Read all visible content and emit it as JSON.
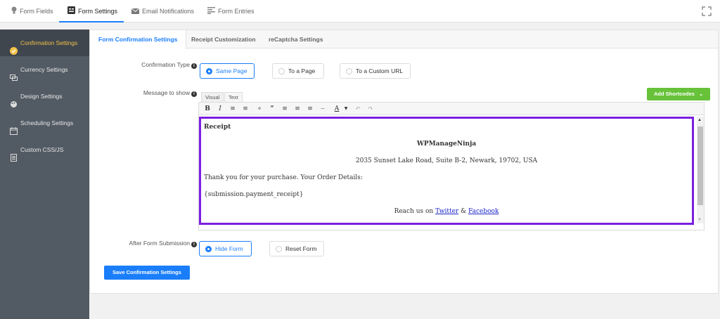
{
  "top_nav": {
    "tabs": [
      {
        "label": "Form Fields"
      },
      {
        "label": "Form Settings"
      },
      {
        "label": "Email Notifications"
      },
      {
        "label": "Form Entries"
      }
    ]
  },
  "sidebar": {
    "items": [
      {
        "label": "Confirmation Settings"
      },
      {
        "label": "Currency Settings"
      },
      {
        "label": "Design Settings"
      },
      {
        "label": "Scheduling Settings"
      },
      {
        "label": "Custom CSS/JS"
      }
    ]
  },
  "sub_tabs": [
    "Form Confirmation Settings",
    "Receipt Customization",
    "reCaptcha Settings"
  ],
  "confirmation_type": {
    "label": "Confirmation Type",
    "options": [
      "Same Page",
      "To a Page",
      "To a Custom URL"
    ],
    "selected": "Same Page"
  },
  "message": {
    "label": "Message to show",
    "editor_tabs": [
      "Visual",
      "Text"
    ],
    "add_shortcodes_label": "Add Shortcodes",
    "content": {
      "heading": "Receipt",
      "company": "WPManageNinja",
      "address": "2035 Sunset Lake Road, Suite B-2, Newark, 19702, USA",
      "thanks": "Thank you for your purchase. Your Order Details:",
      "shortcode": "{submission.payment_receipt}",
      "reach_prefix": "Reach us on",
      "reach_join": "&",
      "twitter": "Twitter",
      "facebook": "Facebook"
    }
  },
  "after_submission": {
    "label": "After Form Submission",
    "options": [
      "Hide Form",
      "Reset Form"
    ],
    "selected": "Hide Form"
  },
  "save_label": "Save Confirmation Settings",
  "colors": {
    "accent": "#1a7efb",
    "sidebar_bg": "#525a63",
    "sidebar_active_text": "#f3c34a",
    "shortcode_button": "#67c23a",
    "highlight_border": "#7a1fe0"
  }
}
